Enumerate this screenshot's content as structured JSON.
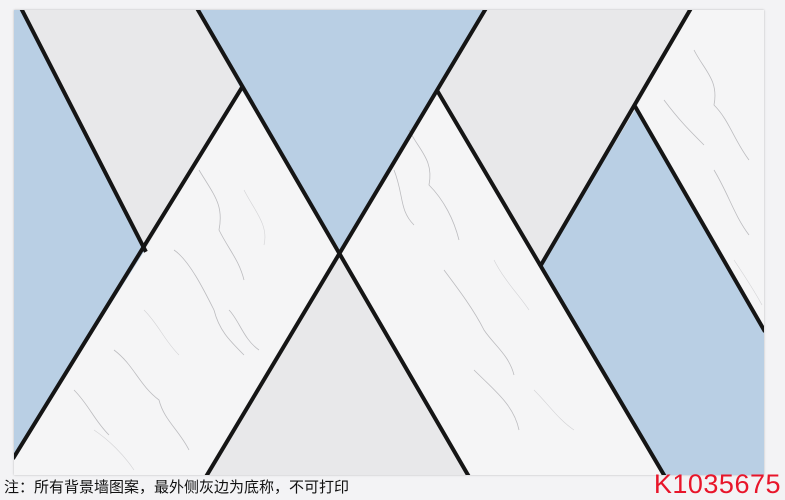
{
  "footer": {
    "note": "注：所有背景墙图案，最外侧灰边为底称，不可打印",
    "product_code": "K1035675"
  },
  "colors": {
    "blue": "#b9cfe4",
    "gray": "#e8e8ea",
    "marble": "#f5f5f6",
    "line": "#151515",
    "code_red": "#e8152a"
  },
  "icons": [
    "marble-texture"
  ]
}
